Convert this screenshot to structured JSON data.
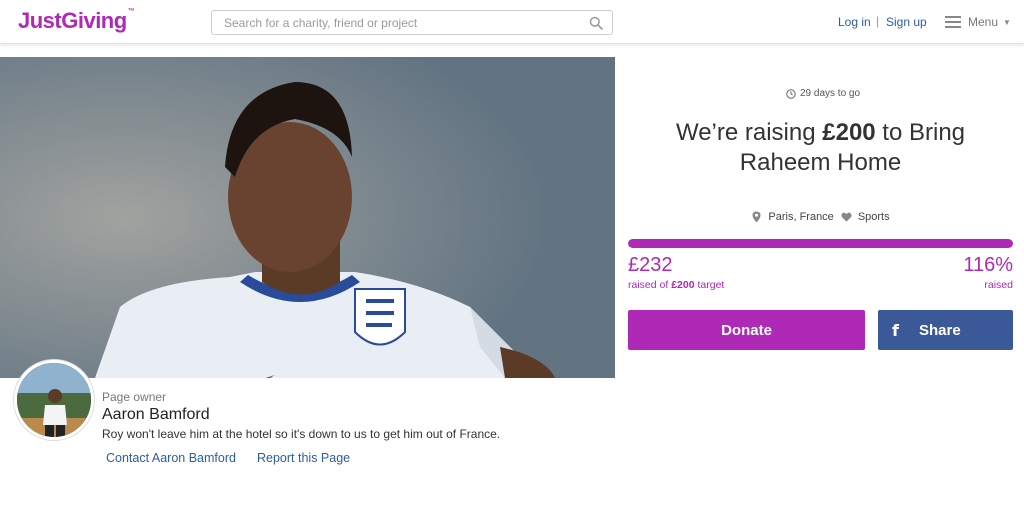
{
  "header": {
    "logo_text": "JustGiving",
    "logo_mark": "™",
    "search_placeholder": "Search for a charity, friend or project",
    "login_label": "Log in",
    "separator": "|",
    "signup_label": "Sign up",
    "menu_label": "Menu",
    "brand_color": "#ad29b6"
  },
  "hero": {
    "image_subject": "footballer in white England shirt"
  },
  "owner": {
    "role_label": "Page owner",
    "name": "Aaron Bamford",
    "description": "Roy won't leave him at the hotel so it's down to us to get him out of France.",
    "contact_link": "Contact Aaron Bamford",
    "report_link": "Report this Page"
  },
  "campaign": {
    "days_left": "29 days to go",
    "title_prefix": "We’re raising ",
    "title_amount": "£200",
    "title_suffix": " to Bring Raheem Home",
    "location": "Paris, France",
    "category": "Sports",
    "raised_amount": "£232",
    "raised_sub_prefix": "raised of ",
    "raised_sub_target": "£200",
    "raised_sub_suffix": " target",
    "percent": "116%",
    "percent_sub": "raised",
    "progress_fraction": 1.0,
    "donate_label": "Donate",
    "share_label": "Share",
    "donate_color": "#ad29b6",
    "share_color": "#3b5998"
  }
}
